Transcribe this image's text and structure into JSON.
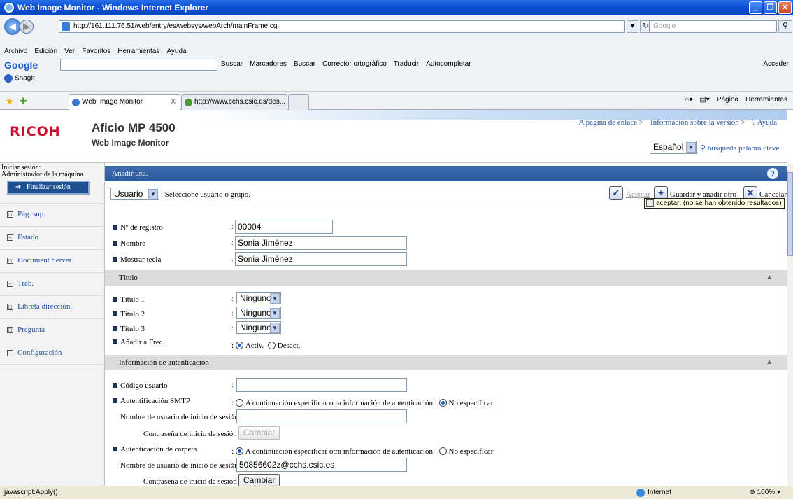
{
  "window": {
    "title": "Web Image Monitor - Windows Internet Explorer"
  },
  "browser": {
    "url": "http://161.111.76.51/web/entry/es/websys/webArch/mainFrame.cgi",
    "search_placeholder": "Google",
    "menu": [
      "Archivo",
      "Edición",
      "Ver",
      "Favoritos",
      "Herramientas",
      "Ayuda"
    ],
    "google_toolbar": {
      "logo": "Google",
      "items": [
        "Buscar",
        "Marcadores",
        "Buscar",
        "Corrector ortográfico",
        "Traducir",
        "Autocompletar"
      ],
      "account": "Acceder"
    },
    "snagit": "SnagIt",
    "tabs": [
      {
        "label": "Web Image Monitor",
        "close": "X"
      },
      {
        "label": "http://www.cchs.csic.es/des..."
      }
    ],
    "command_bar": [
      "Página",
      "Herramientas"
    ],
    "status": {
      "text": "javascript:Apply()",
      "zone": "Internet",
      "zoom": "100%"
    }
  },
  "header": {
    "brand": "RICOH",
    "model": "Aficio MP 4500",
    "subtitle": "Web Image Monitor",
    "links": [
      "A página de enlace >",
      "Información sobre la versión >",
      "? Ayuda"
    ],
    "language": "Español",
    "keyword_search": "búsqueda palabra clave"
  },
  "sidebar": {
    "login_label": "Iniciar sesión:",
    "login_user": "Administrador de la máquina",
    "logout": "Finalizar sesión",
    "items": [
      {
        "label": "Pág. sup.",
        "box": "□"
      },
      {
        "label": "Estado",
        "box": "+"
      },
      {
        "label": "Document Server",
        "box": "□"
      },
      {
        "label": "Trab.",
        "box": "+"
      },
      {
        "label": "Libreta dirección.",
        "box": "□"
      },
      {
        "label": "Pregunta",
        "box": "□"
      },
      {
        "label": "Configuración",
        "box": "+"
      }
    ]
  },
  "form": {
    "heading": "Añadir usu.",
    "type_select": "Usuario",
    "type_hint": ": Seleccione usuario o grupo.",
    "actions": {
      "accept": "Aceptar",
      "save_add": "Guardar y añadir otro",
      "cancel": "Cancelar"
    },
    "tooltip": "aceptar: (no se han obtenido resultados)",
    "registration": {
      "label": "Nº de registro",
      "value": "00004"
    },
    "name": {
      "label": "Nombre",
      "value": "Sonia Jiménez"
    },
    "display_key": {
      "label": "Mostrar tecla",
      "value": "Sonia Jiménez"
    },
    "title_section": "Título",
    "titles": [
      {
        "label": "Título 1",
        "value": "Ninguno"
      },
      {
        "label": "Título 2",
        "value": "Ninguno"
      },
      {
        "label": "Título 3",
        "value": "Ninguno"
      }
    ],
    "add_freq": {
      "label": "Añadir a Frec.",
      "on": "Activ.",
      "off": "Desact."
    },
    "auth_section": "Información de autenticación",
    "user_code": {
      "label": "Código usuario",
      "value": ""
    },
    "smtp": {
      "label": "Autentificación SMTP",
      "opt1": "A continuación especificar otra información de autenticación:",
      "opt2": "No especificar"
    },
    "smtp_user": {
      "label": "Nombre de usuario de inicio de sesión",
      "value": ""
    },
    "smtp_pass": {
      "label": "Contraseña de inicio de sesión",
      "button": "Cambiar"
    },
    "folder": {
      "label": "Autenticación de carpeta",
      "opt1": "A continuación especificar otra información de autenticación:",
      "opt2": "No especificar"
    },
    "folder_user": {
      "label": "Nombre de usuario de inicio de sesión",
      "value": "50856602z@cchs.csic.es"
    },
    "folder_pass": {
      "label": "Contraseña de inicio de sesión",
      "button": "Cambiar"
    }
  }
}
